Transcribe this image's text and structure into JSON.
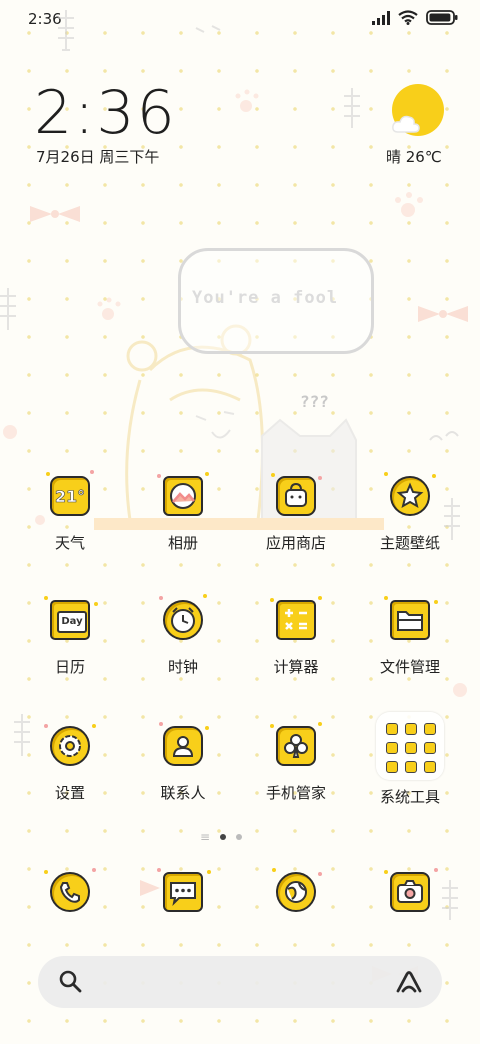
{
  "status_bar": {
    "time": "2:36",
    "battery_level": 0.95
  },
  "clock_widget": {
    "time": "2:36",
    "date": "7月26日 周三下午"
  },
  "weather_widget": {
    "text": "晴 26℃"
  },
  "wallpaper": {
    "speech_text": "You're a fool",
    "question_marks": "???"
  },
  "apps": [
    {
      "label": "天气",
      "icon": "weather-icon",
      "icon_text": "21°"
    },
    {
      "label": "相册",
      "icon": "gallery-icon"
    },
    {
      "label": "应用商店",
      "icon": "app-store-icon"
    },
    {
      "label": "主题壁纸",
      "icon": "themes-icon"
    },
    {
      "label": "日历",
      "icon": "calendar-icon",
      "icon_text": "Day"
    },
    {
      "label": "时钟",
      "icon": "clock-icon"
    },
    {
      "label": "计算器",
      "icon": "calculator-icon"
    },
    {
      "label": "文件管理",
      "icon": "file-manager-icon"
    },
    {
      "label": "设置",
      "icon": "settings-icon"
    },
    {
      "label": "联系人",
      "icon": "contacts-icon"
    },
    {
      "label": "手机管家",
      "icon": "security-icon"
    },
    {
      "label": "系统工具",
      "icon": "system-tools-folder-icon"
    }
  ],
  "dock": [
    {
      "icon": "phone-icon"
    },
    {
      "icon": "messages-icon"
    },
    {
      "icon": "browser-icon"
    },
    {
      "icon": "camera-icon"
    }
  ],
  "page_indicator": {
    "pages": 2,
    "current": 1
  },
  "colors": {
    "accent": "#f8cf1a",
    "outline": "#2b2b2b",
    "background": "#fefdf8"
  }
}
